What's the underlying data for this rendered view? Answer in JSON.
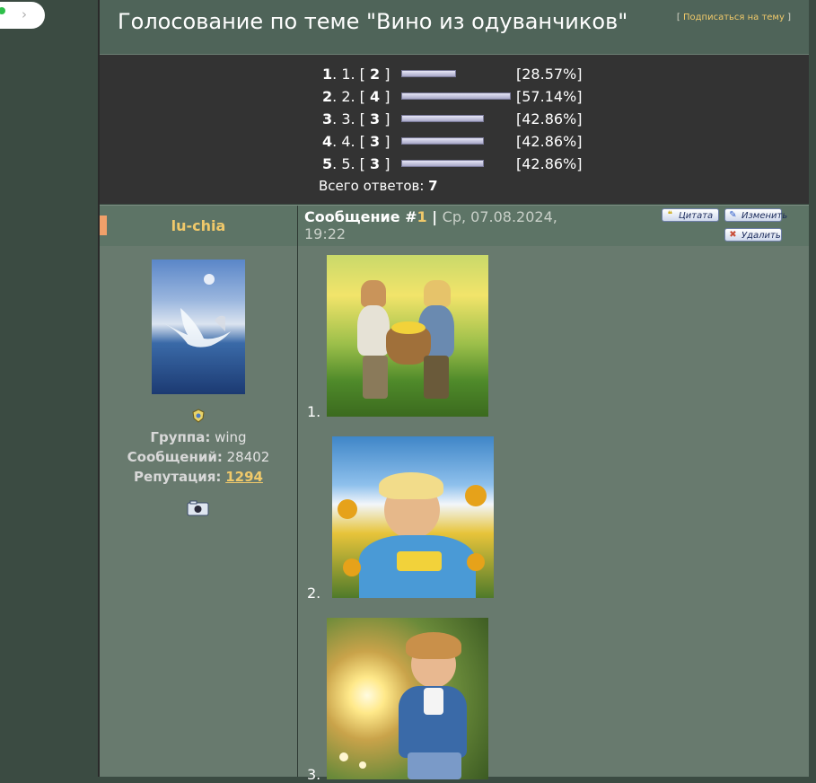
{
  "toggle": {
    "chevron": "›"
  },
  "header": {
    "title": "Голосование по теме \"Вино из одуванчиков\"",
    "subscribe_open": "[ ",
    "subscribe_label": "Подписаться на тему",
    "subscribe_close": " ]"
  },
  "poll": {
    "rows": [
      {
        "num": "1",
        "label": ". 1. [ ",
        "votes": "2",
        "close": " ]",
        "pct": "[28.57%]",
        "fraction": 0.2857
      },
      {
        "num": "2",
        "label": ". 2. [ ",
        "votes": "4",
        "close": " ]",
        "pct": "[57.14%]",
        "fraction": 0.5714
      },
      {
        "num": "3",
        "label": ". 3. [ ",
        "votes": "3",
        "close": " ]",
        "pct": "[42.86%]",
        "fraction": 0.4286
      },
      {
        "num": "4",
        "label": ". 4. [ ",
        "votes": "3",
        "close": " ]",
        "pct": "[42.86%]",
        "fraction": 0.4286
      },
      {
        "num": "5",
        "label": ". 5. [ ",
        "votes": "3",
        "close": " ]",
        "pct": "[42.86%]",
        "fraction": 0.4286
      }
    ],
    "total_label": "Всего ответов: ",
    "total_value": "7"
  },
  "post": {
    "author": "lu-chia",
    "message_label": "Сообщение #",
    "message_number": "1",
    "separator": " | ",
    "date": "Ср, 07.08.2024, 19:22",
    "buttons": {
      "quote": "Цитата",
      "edit": "Изменить",
      "delete": "Удалить"
    },
    "user": {
      "group_label": "Группа:",
      "group_value": " wing",
      "messages_label": "Сообщений:",
      "messages_value": " 28402",
      "reputation_label": "Репутация:",
      "reputation_value": "1294"
    },
    "images": [
      {
        "index": "1."
      },
      {
        "index": "2."
      },
      {
        "index": "3."
      }
    ]
  },
  "colors": {
    "accent": "#f0c96a",
    "header_bg": "#4f6459",
    "poll_bg": "#333333",
    "body_bg": "#687a6e"
  }
}
